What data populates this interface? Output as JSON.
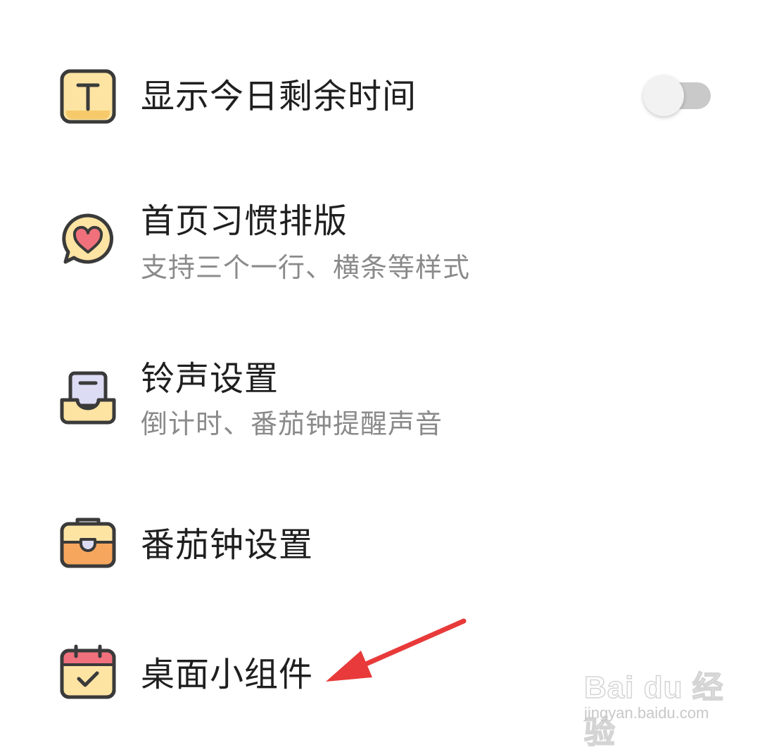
{
  "items": [
    {
      "title": "显示今日剩余时间",
      "icon": "text-t-icon",
      "has_toggle": true,
      "toggle_on": false
    },
    {
      "title": "首页习惯排版",
      "subtitle": "支持三个一行、横条等样式",
      "icon": "heart-bubble-icon"
    },
    {
      "title": "铃声设置",
      "subtitle": "倒计时、番茄钟提醒声音",
      "icon": "inbox-tray-icon"
    },
    {
      "title": "番茄钟设置",
      "icon": "toolbox-icon"
    },
    {
      "title": "桌面小组件",
      "icon": "calendar-check-icon"
    }
  ],
  "colors": {
    "icon_yellow": "#fde4a3",
    "icon_orange": "#f7a65e",
    "icon_pink": "#f0717c",
    "icon_lavender": "#dcdcf4",
    "outline": "#3a3a3a",
    "annotation_arrow": "#e83a3a"
  },
  "watermark": {
    "logo": "Bai du 经验",
    "url": "jingyan.baidu.com"
  }
}
